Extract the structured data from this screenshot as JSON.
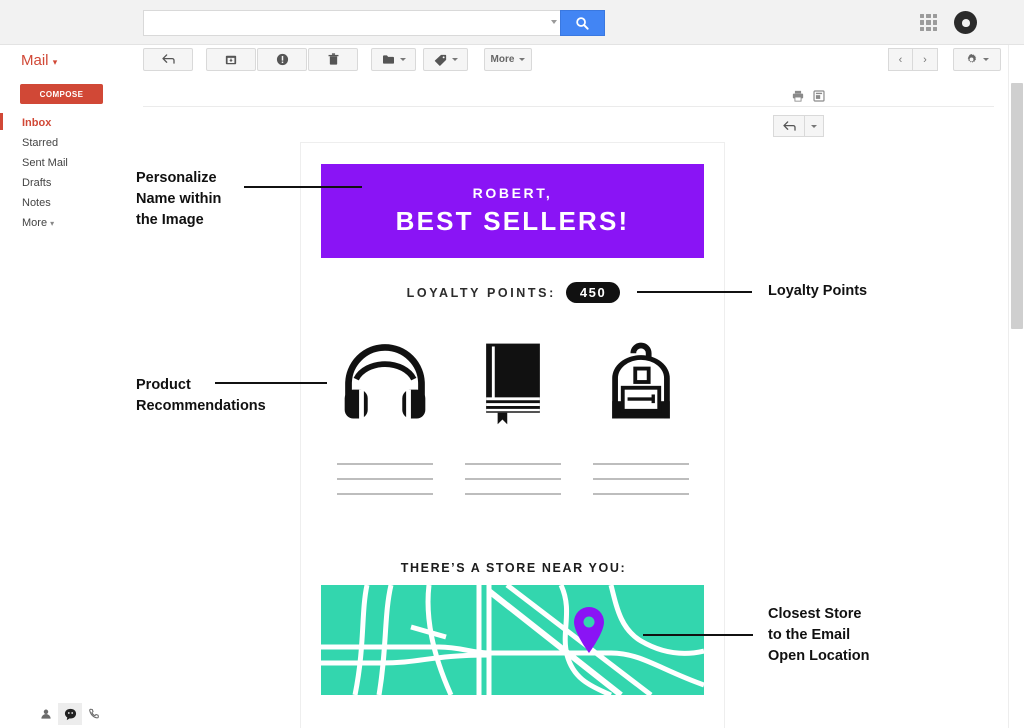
{
  "topbar": {
    "search_placeholder": "",
    "search_value": "",
    "search_button_icon": "search-icon",
    "apps_icon": "apps-grid-icon",
    "avatar_icon": "account-avatar-icon"
  },
  "toolbar": {
    "mail_label": "Mail",
    "mail_caret": "▾",
    "buttons": [
      {
        "name": "back",
        "icon": "back-arrow-icon",
        "label": ""
      },
      {
        "name": "archive",
        "icon": "archive-icon",
        "label": ""
      },
      {
        "name": "report-spam",
        "icon": "exclamation-circle-icon",
        "label": ""
      },
      {
        "name": "delete",
        "icon": "trash-icon",
        "label": ""
      },
      {
        "name": "move-to",
        "icon": "folder-icon",
        "label": ""
      },
      {
        "name": "labels",
        "icon": "tag-icon",
        "label": ""
      },
      {
        "name": "more",
        "icon": "",
        "label": "More"
      }
    ],
    "prev_label": "‹",
    "next_label": "›",
    "settings_icon": "gear-icon"
  },
  "sidebar": {
    "compose_label": "COMPOSE",
    "items": [
      {
        "label": "Inbox",
        "active": true
      },
      {
        "label": "Starred",
        "active": false
      },
      {
        "label": "Sent Mail",
        "active": false
      },
      {
        "label": "Drafts",
        "active": false
      },
      {
        "label": "Notes",
        "active": false
      },
      {
        "label": "More",
        "active": false,
        "caret": "▾"
      }
    ],
    "bottom_icons": [
      {
        "name": "contacts-person-icon",
        "selected": false
      },
      {
        "name": "chat-bubble-icon",
        "selected": true
      },
      {
        "name": "phone-icon",
        "selected": false
      }
    ]
  },
  "reading_pane": {
    "print_icon": "printer-icon",
    "popout_icon": "open-in-new-window-icon",
    "reply_icon": "reply-arrow-icon",
    "reply_caret": "▾"
  },
  "email": {
    "banner": {
      "greeting": "ROBERT,",
      "headline": "BEST SELLERS!",
      "background_color": "#8a14f5",
      "text_color": "#ffffff"
    },
    "loyalty": {
      "label": "LOYALTY POINTS:",
      "points": "450",
      "pill_color": "#111111"
    },
    "products": [
      {
        "icon": "headphones-icon",
        "lines": 3
      },
      {
        "icon": "book-icon",
        "lines": 3
      },
      {
        "icon": "backpack-icon",
        "lines": 3
      }
    ],
    "store": {
      "heading": "THERE’S A STORE NEAR YOU:",
      "map_color": "#33d6ae",
      "road_color": "#ffffff",
      "pin_icon": "map-pin-icon",
      "pin_color": "#8a14f5"
    }
  },
  "annotations": [
    {
      "id": "personalize",
      "text": "Personalize\nName within\nthe Image",
      "side": "left"
    },
    {
      "id": "product-recommendations",
      "text": "Product\nRecommendations",
      "side": "left"
    },
    {
      "id": "loyalty-points",
      "text": "Loyalty Points",
      "side": "right"
    },
    {
      "id": "closest-store",
      "text": "Closest Store\nto the Email\nOpen Location",
      "side": "right"
    }
  ]
}
